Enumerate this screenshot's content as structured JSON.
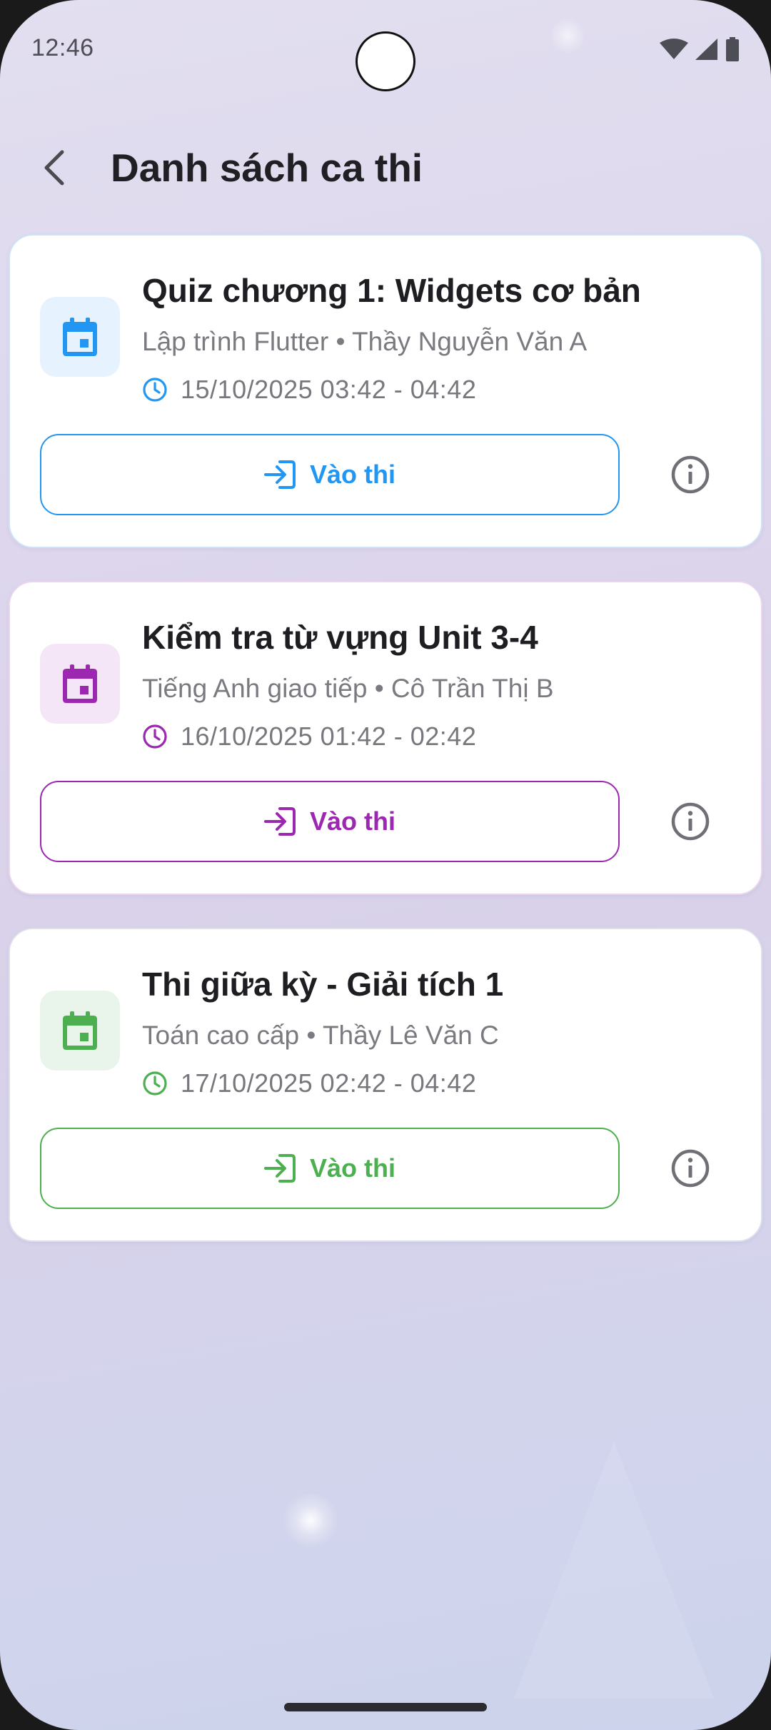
{
  "status_bar": {
    "time": "12:46"
  },
  "header": {
    "title": "Danh sách ca thi"
  },
  "exams": [
    {
      "title": "Quiz chương 1: Widgets cơ bản",
      "subtitle": "Lập trình Flutter • Thầy Nguyễn Văn A",
      "time": "15/10/2025 03:42 - 04:42",
      "button_label": "Vào thi",
      "accent": "#2196F3",
      "tile_bg": "#e6f2fd"
    },
    {
      "title": "Kiểm tra từ vựng Unit 3-4",
      "subtitle": "Tiếng Anh giao tiếp • Cô Trần Thị B",
      "time": "16/10/2025 01:42 - 02:42",
      "button_label": "Vào thi",
      "accent": "#9C27B0",
      "tile_bg": "#f4e6f6"
    },
    {
      "title": "Thi giữa kỳ - Giải tích 1",
      "subtitle": "Toán cao cấp • Thầy Lê Văn C",
      "time": "17/10/2025 02:42 - 04:42",
      "button_label": "Vào thi",
      "accent": "#4CAF50",
      "tile_bg": "#e9f5ea"
    }
  ],
  "icons": {
    "back": "arrow-back-icon",
    "calendar": "calendar-icon",
    "clock": "clock-icon",
    "login": "login-icon",
    "info": "info-icon"
  }
}
